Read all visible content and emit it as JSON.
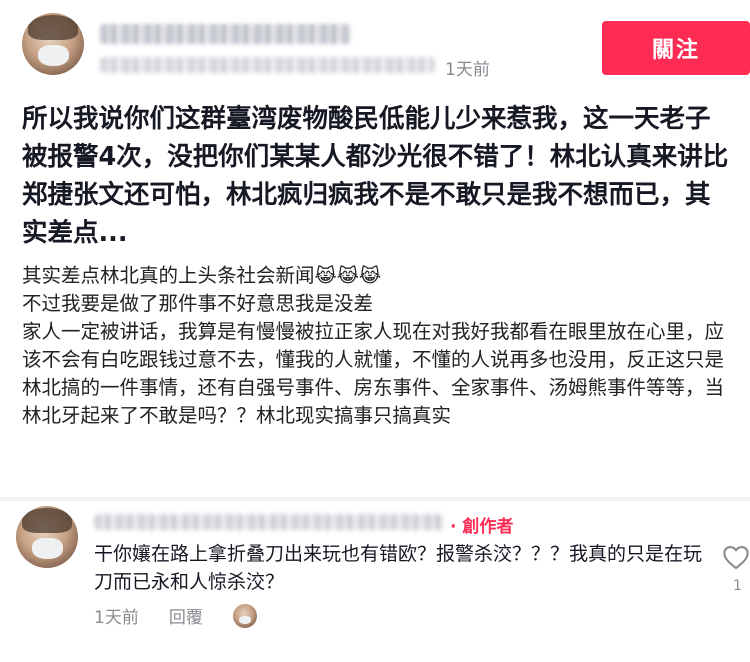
{
  "post": {
    "follow_label": "關注",
    "time_ago": "1天前",
    "caption": "所以我说你们这群臺湾废物酸民低能儿少来惹我，这一天老子被报警4次，没把你们某某人都沙光很不错了！林北认真来讲比郑捷张文还可怕，林北疯归疯我不是不敢只是我不想而已，其实差点...",
    "body": {
      "line1": "其实差点林北真的上头条社会新闻",
      "line1_emoji": "😹😹😹",
      "line2": "不过我要是做了那件事不好意思我是没差",
      "line3": "家人一定被讲话，我算是有慢慢被拉正家人现在对我好我都看在眼里放在心里，应该不会有白吃跟钱过意不去，懂我的人就懂，不懂的人说再多也没用，反正这只是林北搞的一件事情，还有自强号事件、房东事件、全家事件、汤姆熊事件等等，当林北牙起来了不敢是吗？？林北现实搞事只搞真实"
    }
  },
  "comment": {
    "creator_tag": "· 創作者",
    "text": "干你孃在路上拿折叠刀出来玩也有错欧？报警杀洨？？？我真的只是在玩刀而已永和人惊杀洨？",
    "time_ago": "1天前",
    "reply_label": "回覆",
    "like_count": "1"
  },
  "icons": {
    "like": "heart-outline-icon",
    "avatar": "user-avatar"
  },
  "colors": {
    "accent": "#fe2c55",
    "muted": "#8a8b91",
    "text": "#161823"
  }
}
